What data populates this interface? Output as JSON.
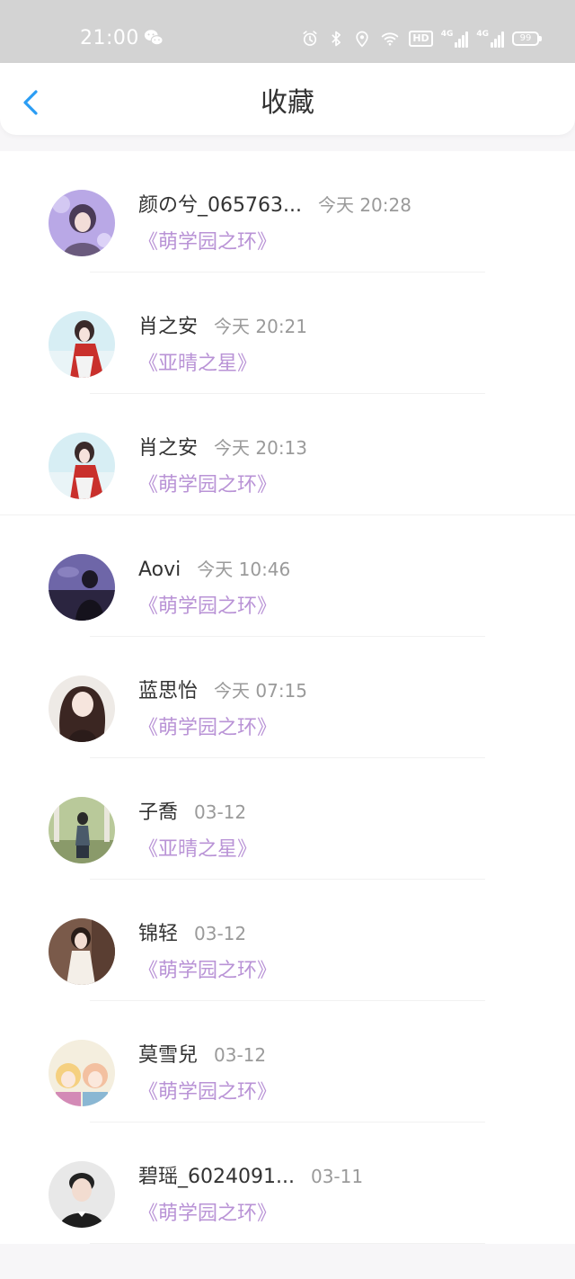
{
  "status_bar": {
    "time": "21:00",
    "battery": "99",
    "hd_label": "HD",
    "signal_label": "4G"
  },
  "header": {
    "title": "收藏",
    "back_icon": "chevron-left-icon"
  },
  "colors": {
    "accent": "#2a9df4",
    "book_title": "#b993d6",
    "status_bar_bg": "#d3d3d3"
  },
  "items": [
    {
      "name": "颜の兮_065763...",
      "time": "今天 20:28",
      "book": "《萌学园之环》"
    },
    {
      "name": "肖之安",
      "time": "今天 20:21",
      "book": "《亚晴之星》"
    },
    {
      "name": "肖之安",
      "time": "今天 20:13",
      "book": "《萌学园之环》"
    },
    {
      "name": "Aovi",
      "time": "今天 10:46",
      "book": "《萌学园之环》"
    },
    {
      "name": "蓝思怡",
      "time": "今天 07:15",
      "book": "《萌学园之环》"
    },
    {
      "name": "子喬",
      "time": "03-12",
      "book": "《亚晴之星》"
    },
    {
      "name": "锦轻",
      "time": "03-12",
      "book": "《萌学园之环》"
    },
    {
      "name": "莫雪兒",
      "time": "03-12",
      "book": "《萌学园之环》"
    },
    {
      "name": "碧瑶_6024091...",
      "time": "03-11",
      "book": "《萌学园之环》"
    }
  ]
}
